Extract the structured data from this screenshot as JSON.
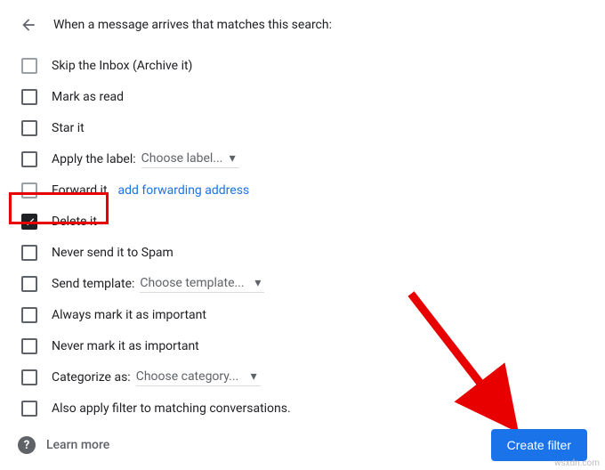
{
  "header": {
    "title": "When a message arrives that matches this search:"
  },
  "options": {
    "skip_inbox": "Skip the Inbox (Archive it)",
    "mark_read": "Mark as read",
    "star": "Star it",
    "apply_label": "Apply the label:",
    "label_select": "Choose label...",
    "forward": "Forward it",
    "forward_link": "add forwarding address",
    "delete": "Delete it",
    "never_spam": "Never send it to Spam",
    "send_template": "Send template:",
    "template_select": "Choose template...",
    "always_important": "Always mark it as important",
    "never_important": "Never mark it as important",
    "categorize": "Categorize as:",
    "category_select": "Choose category...",
    "apply_matching": "Also apply filter to matching conversations."
  },
  "footer": {
    "learn_more": "Learn more",
    "create": "Create filter"
  },
  "watermark": "wsxdn.com"
}
